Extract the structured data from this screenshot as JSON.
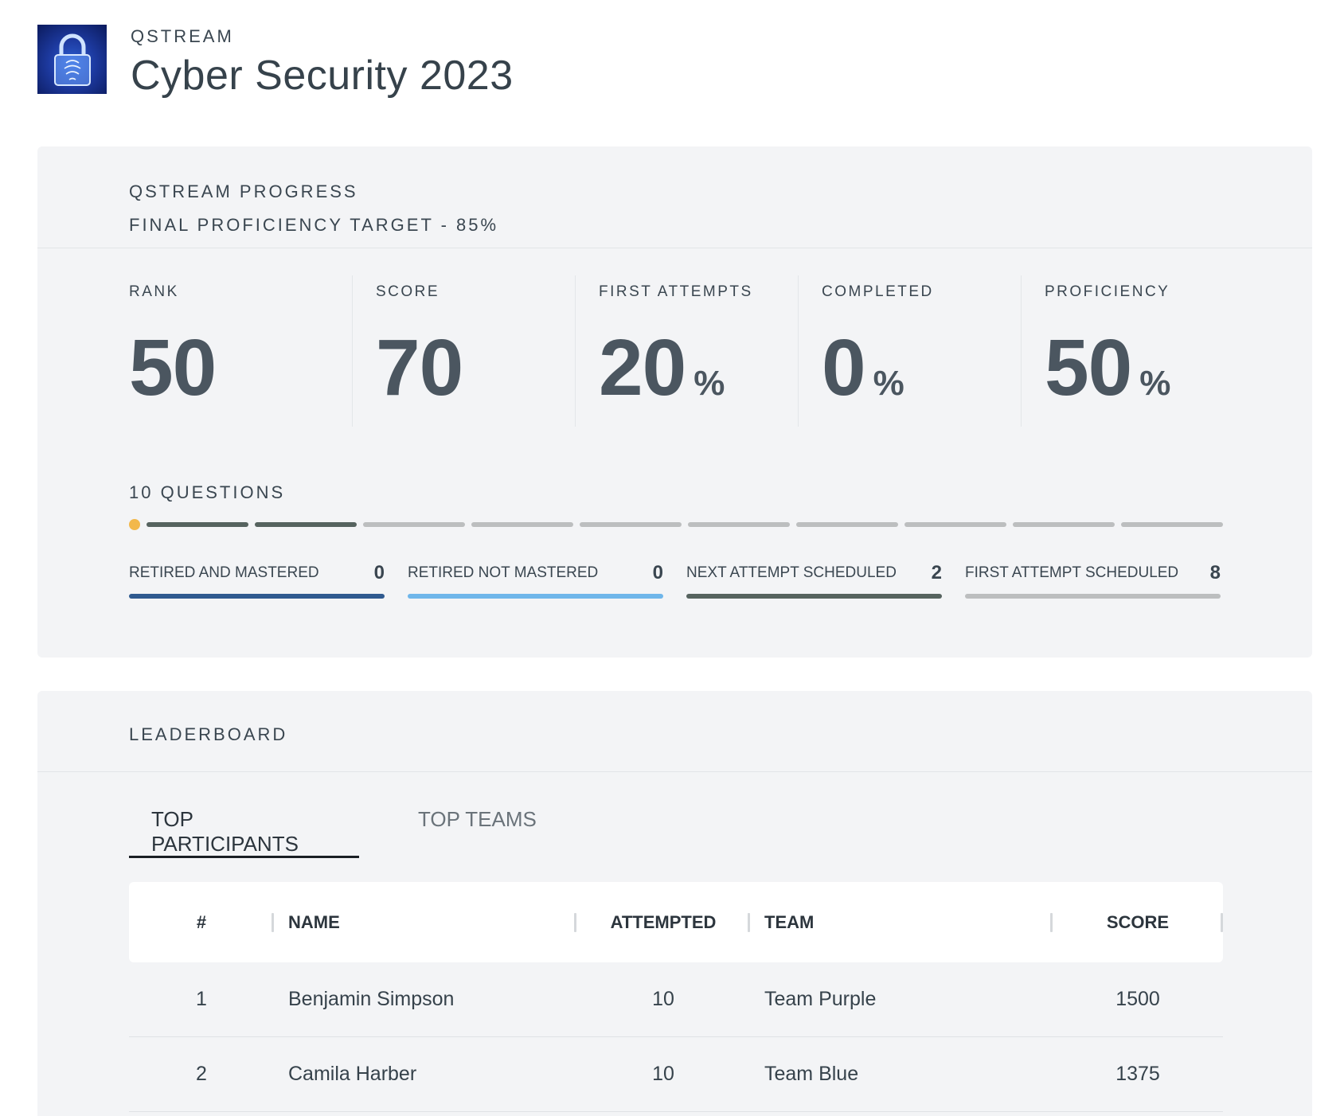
{
  "header": {
    "logo_icon": "padlock-icon",
    "kicker": "QSTREAM",
    "title": "Cyber Security 2023"
  },
  "progress": {
    "heading": "QSTREAM PROGRESS",
    "target": "FINAL PROFICIENCY TARGET - 85%",
    "stats": [
      {
        "label": "RANK",
        "value": "50",
        "unit": ""
      },
      {
        "label": "SCORE",
        "value": "70",
        "unit": ""
      },
      {
        "label": "FIRST ATTEMPTS",
        "value": "20",
        "unit": "%"
      },
      {
        "label": "COMPLETED",
        "value": "0",
        "unit": "%"
      },
      {
        "label": "PROFICIENCY",
        "value": "50",
        "unit": "%"
      }
    ],
    "questions_label": "10 QUESTIONS",
    "question_total": 10,
    "questions_done": 2,
    "current_marker_color": "#f2b84b",
    "legend": [
      {
        "label": "RETIRED AND MASTERED",
        "count": "0",
        "color": "#2f5a8f"
      },
      {
        "label": "RETIRED NOT MASTERED",
        "count": "0",
        "color": "#6fb6ea"
      },
      {
        "label": "NEXT ATTEMPT SCHEDULED",
        "count": "2",
        "color": "#56635f"
      },
      {
        "label": "FIRST ATTEMPT SCHEDULED",
        "count": "8",
        "color": "#bcbebf"
      }
    ]
  },
  "leaderboard": {
    "heading": "LEADERBOARD",
    "tabs": [
      {
        "label": "TOP PARTICIPANTS",
        "active": true
      },
      {
        "label": "TOP TEAMS",
        "active": false
      }
    ],
    "columns": [
      "#",
      "NAME",
      "ATTEMPTED",
      "TEAM",
      "SCORE"
    ],
    "rows": [
      {
        "rank": "1",
        "name": "Benjamin Simpson",
        "attempted": "10",
        "team": "Team Purple",
        "score": "1500"
      },
      {
        "rank": "2",
        "name": "Camila Harber",
        "attempted": "10",
        "team": "Team Blue",
        "score": "1375"
      }
    ]
  }
}
